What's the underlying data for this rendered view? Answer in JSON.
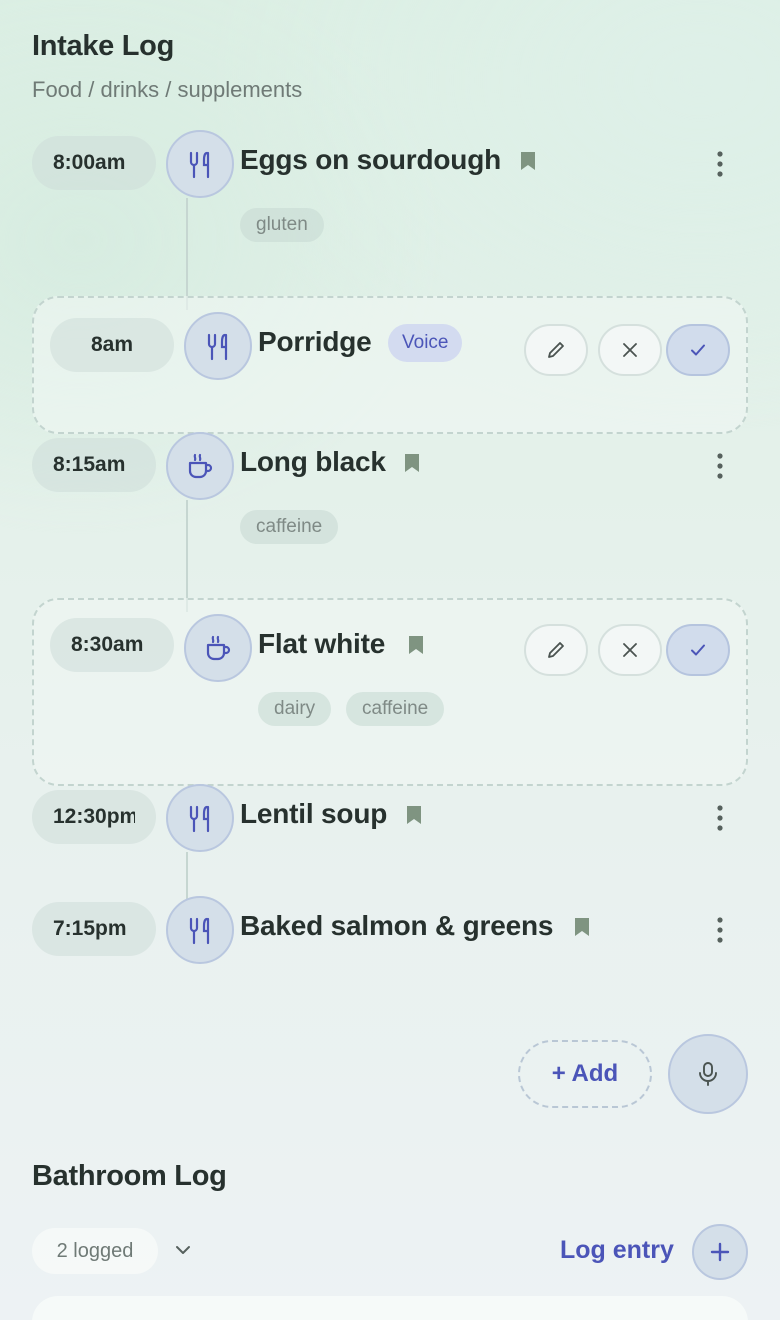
{
  "intake": {
    "title": "Intake Log",
    "subtitle": "Food / drinks / supplements",
    "entries": [
      {
        "time": "8:00am",
        "icon": "fork-knife-icon",
        "name": "Eggs on sourdough",
        "tags": [
          "gluten"
        ]
      },
      {
        "time": "8am",
        "icon": "fork-knife-icon",
        "name": "Porridge",
        "badge": "Voice",
        "tags": []
      },
      {
        "time": "8:15am",
        "icon": "coffee-cup-icon",
        "name": "Long black",
        "tags": [
          "caffeine"
        ]
      },
      {
        "time": "8:30am",
        "icon": "coffee-cup-icon",
        "name": "Flat white",
        "tags": [
          "dairy",
          "caffeine"
        ]
      },
      {
        "time": "12:30pm",
        "icon": "fork-knife-icon",
        "name": "Lentil soup",
        "tags": []
      },
      {
        "time": "7:15pm",
        "icon": "fork-knife-icon",
        "name": "Baked salmon & greens",
        "tags": []
      }
    ],
    "add_label": "+ Add"
  },
  "bathroom": {
    "title": "Bathroom Log",
    "count_label": "2 logged",
    "log_entry_label": "Log entry"
  },
  "colors": {
    "accent": "#4b55b8",
    "bookmark": "#7f9481",
    "avatar_bg": "#d4dfe9"
  }
}
